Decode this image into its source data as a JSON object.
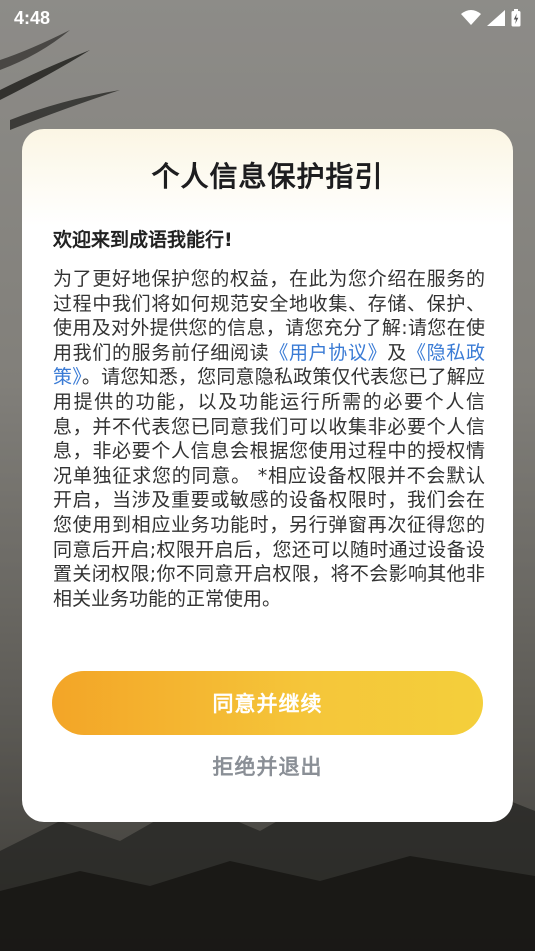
{
  "status_bar": {
    "time": "4:48",
    "icons": [
      "wifi-icon",
      "signal-icon",
      "battery-charging-icon"
    ]
  },
  "dialog": {
    "title": "个人信息保护指引",
    "welcome": "欢迎来到成语我能行!",
    "body_part1": "为了更好地保护您的权益，在此为您介绍在服务的过程中我们将如何规范安全地收集、存储、保护、使用及对外提供您的信息，请您充分了解:请您在使用我们的服务前仔细阅读",
    "user_agreement_link": "《用户协议》",
    "conjunction": "及",
    "privacy_policy_link": "《隐私政策》",
    "body_part2": "。请您知悉，您同意隐私政策仅代表您已了解应用提供的功能，以及功能运行所需的必要个人信息，并不代表您已同意我们可以收集非必要个人信息，非必要个人信息会根据您使用过程中的授权情况单独征求您的同意。 *相应设备权限并不会默认开启，当涉及重要或敏感的设备权限时，我们会在您使用到相应业务功能时，另行弹窗再次征得您的同意后开启;权限开启后，您还可以随时通过设备设置关闭权限;你不同意开启权限，将不会影响其他非相关业务功能的正常使用。",
    "agree_label": "同意并继续",
    "reject_label": "拒绝并退出"
  },
  "colors": {
    "accent_start": "#f3a527",
    "accent_end": "#f4cf3b",
    "link": "#3a7bd5",
    "reject_text": "#8a8f96"
  }
}
